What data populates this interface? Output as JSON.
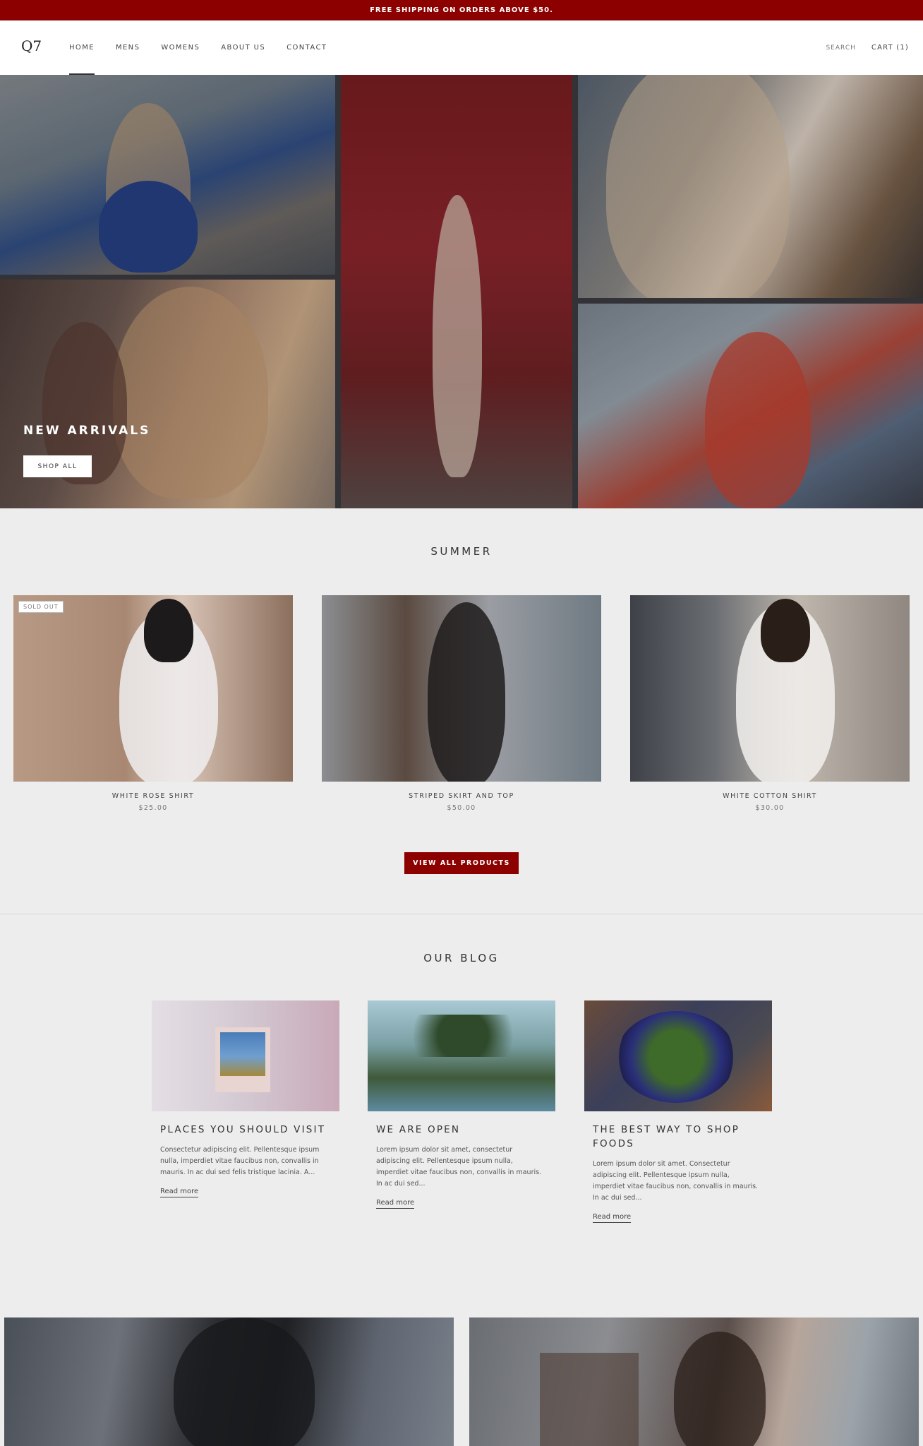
{
  "announcement": {
    "text": "FREE SHIPPING ON ORDERS ABOVE $50."
  },
  "header": {
    "logo": "Q7",
    "nav": [
      {
        "label": "HOME",
        "active": true
      },
      {
        "label": "MENS",
        "active": false
      },
      {
        "label": "WOMENS",
        "active": false
      },
      {
        "label": "ABOUT US",
        "active": false
      },
      {
        "label": "CONTACT",
        "active": false
      }
    ],
    "search_label": "SEARCH",
    "cart_label": "CART (1)"
  },
  "hero": {
    "title": "NEW ARRIVALS",
    "button_label": "SHOP ALL"
  },
  "summer": {
    "title": "SUMMER",
    "products": [
      {
        "name": "WHITE ROSE SHIRT",
        "price": "$25.00",
        "badge": "SOLD OUT"
      },
      {
        "name": "STRIPED SKIRT AND TOP",
        "price": "$50.00"
      },
      {
        "name": "WHITE COTTON SHIRT",
        "price": "$30.00"
      }
    ],
    "view_all_label": "VIEW ALL PRODUCTS"
  },
  "blog": {
    "title": "OUR BLOG",
    "posts": [
      {
        "title": "PLACES YOU SHOULD VISIT",
        "excerpt": "Consectetur adipiscing elit. Pellentesque ipsum nulla, imperdiet vitae faucibus non, convallis in mauris. In ac dui sed felis tristique lacinia. A...",
        "link": "Read more"
      },
      {
        "title": "WE ARE OPEN",
        "excerpt": "Lorem ipsum dolor sit amet, consectetur adipiscing elit. Pellentesque ipsum nulla, imperdiet vitae faucibus non, convallis in mauris. In ac dui sed...",
        "link": "Read more"
      },
      {
        "title": "THE BEST WAY TO SHOP FOODS",
        "excerpt": "Lorem ipsum dolor sit amet. Consectetur adipiscing elit. Pellentesque ipsum nulla, imperdiet vitae faucibus non, convallis in mauris. In ac dui sed...",
        "link": "Read more"
      }
    ]
  },
  "colors": {
    "accent": "#8c0000",
    "background": "#ededed"
  }
}
